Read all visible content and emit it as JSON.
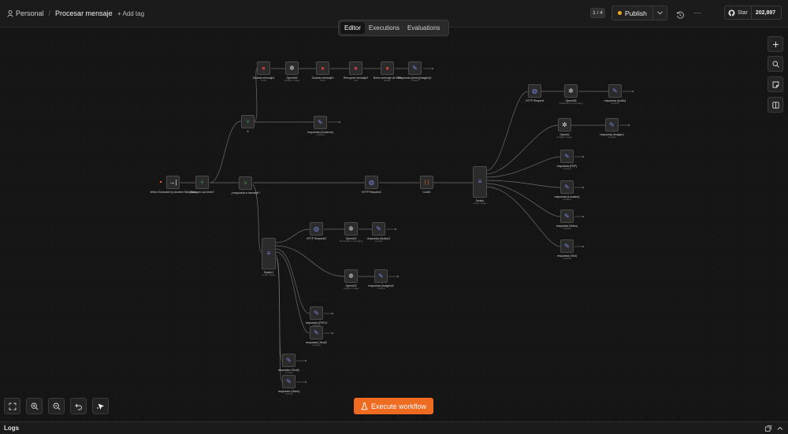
{
  "header": {
    "workspace": "Personal",
    "workflow_name": "Procesar mensaje",
    "add_tag": "+ Add tag",
    "version_badge": "1 / 4",
    "publish": "Publish",
    "github_star": "Star",
    "github_count": "202,897"
  },
  "tabs": [
    "Editor",
    "Executions",
    "Evaluations"
  ],
  "execute_button": "Execute workflow",
  "logs_label": "Logs",
  "colors": {
    "accent": "#ef6b22",
    "router": "#3fb950",
    "http": "#7b86e6",
    "redis": "#d93a3a",
    "publish_dot": "#f0a81a"
  },
  "nodes": [
    {
      "id": "trigger",
      "icon": "→|",
      "label": "When Executed by Another Workflow",
      "sub": ""
    },
    {
      "id": "if1",
      "icon": "⑂",
      "label": "¿Imagen con texto?",
      "sub": ""
    },
    {
      "id": "if2",
      "icon": "⑂",
      "label": "If",
      "sub": ""
    },
    {
      "id": "redis1",
      "icon": "●",
      "label": "Guarda mensaje1",
      "sub": "Push"
    },
    {
      "id": "openai9",
      "icon": "✲",
      "label": "OpenAI9",
      "sub": "Analyze image"
    },
    {
      "id": "redis2",
      "icon": "●",
      "label": "Guarda mensaje2",
      "sub": "Push"
    },
    {
      "id": "redis3",
      "icon": "●",
      "label": "Recupera mensaje2",
      "sub": "Get"
    },
    {
      "id": "redis4",
      "icon": "●",
      "label": "Borra mensaje de BD1",
      "sub": "Delete"
    },
    {
      "id": "resp_texto_img",
      "icon": "✎",
      "label": "respuesta (texto)(imagen)2",
      "sub": "manual"
    },
    {
      "id": "resp_contexto",
      "icon": "✎",
      "label": "respuesta (Contexto)",
      "sub": "manual"
    },
    {
      "id": "if3",
      "icon": "⑂",
      "label": "¿respuesta a mensaje?",
      "sub": ""
    },
    {
      "id": "http1",
      "icon": "◍",
      "label": "HTTP Request1",
      "sub": ""
    },
    {
      "id": "code1",
      "icon": "{ }",
      "label": "Code1",
      "sub": ""
    },
    {
      "id": "switch",
      "icon": "≡",
      "label": "Switch",
      "sub": "mode: Rules"
    },
    {
      "id": "switch1",
      "icon": "≡",
      "label": "Switch1",
      "sub": "mode: Rules"
    },
    {
      "id": "http_top",
      "icon": "◍",
      "label": "HTTP Request",
      "sub": ""
    },
    {
      "id": "openai_top",
      "icon": "✲",
      "label": "OpenAI8",
      "sub": "Transcribe a recording"
    },
    {
      "id": "resp_audio",
      "icon": "✎",
      "label": "respuesta (Audio)",
      "sub": "manual"
    },
    {
      "id": "openai_img",
      "icon": "✲",
      "label": "OpenAI",
      "sub": "Analyze image"
    },
    {
      "id": "resp_imagen",
      "icon": "✎",
      "label": "respuesta (Imagen)",
      "sub": "manual"
    },
    {
      "id": "resp_pdf",
      "icon": "✎",
      "label": "respuesta (PDF)",
      "sub": "manual"
    },
    {
      "id": "resp_location",
      "icon": "✎",
      "label": "respuesta (Location)",
      "sub": "manual"
    },
    {
      "id": "resp_video",
      "icon": "✎",
      "label": "respuesta (Video)",
      "sub": "manual"
    },
    {
      "id": "resp_text",
      "icon": "✎",
      "label": "respuesta (Text)",
      "sub": "manual"
    },
    {
      "id": "http2",
      "icon": "◍",
      "label": "HTTP Request2",
      "sub": ""
    },
    {
      "id": "openai2",
      "icon": "✲",
      "label": "OpenAI2",
      "sub": "Transcribe a recording"
    },
    {
      "id": "resp_audio2",
      "icon": "✎",
      "label": "respuesta (Audio)2",
      "sub": "manual"
    },
    {
      "id": "openai3",
      "icon": "✲",
      "label": "OpenAI3",
      "sub": "Analyze image"
    },
    {
      "id": "resp_imagen2",
      "icon": "✎",
      "label": "respuesta (Imagen)2",
      "sub": "manual"
    },
    {
      "id": "resp_pdf2",
      "icon": "✎",
      "label": "respuesta (PDF)1",
      "sub": "manual"
    },
    {
      "id": "resp_text2",
      "icon": "✎",
      "label": "respuesta (Text)2",
      "sub": "manual"
    },
    {
      "id": "resp_text3",
      "icon": "✎",
      "label": "respuesta (Text)3",
      "sub": "manual"
    },
    {
      "id": "resp_video2",
      "icon": "✎",
      "label": "respuesta (Video)",
      "sub": "manual"
    }
  ]
}
